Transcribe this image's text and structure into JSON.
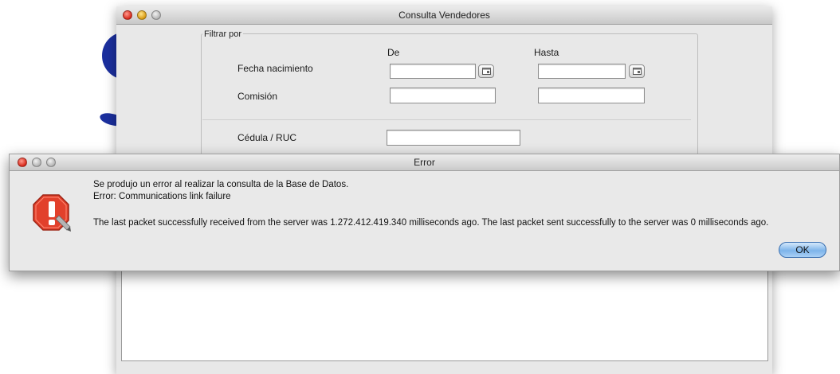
{
  "main_window": {
    "title": "Consulta Vendedores",
    "filter_group_label": "Filtrar por",
    "col_from": "De",
    "col_to": "Hasta",
    "row_birthdate": "Fecha nacimiento",
    "row_commission": "Comisión",
    "row_id": "Cédula / RUC"
  },
  "error_dialog": {
    "title": "Error",
    "message_line1": "Se produjo un error al realizar la consulta de la Base de Datos.",
    "message_line2": "Error: Communications link failure",
    "message_line3": "The last packet successfully received from the server was 1.272.412.419.340 milliseconds ago.  The last packet sent successfully to the server was 0 milliseconds ago.",
    "ok_label": "OK"
  },
  "icons": {
    "error": "warning-stop-icon",
    "calendar": "calendar-icon"
  },
  "colors": {
    "accent": "#7db4ea",
    "error_icon": "#e2402b"
  }
}
